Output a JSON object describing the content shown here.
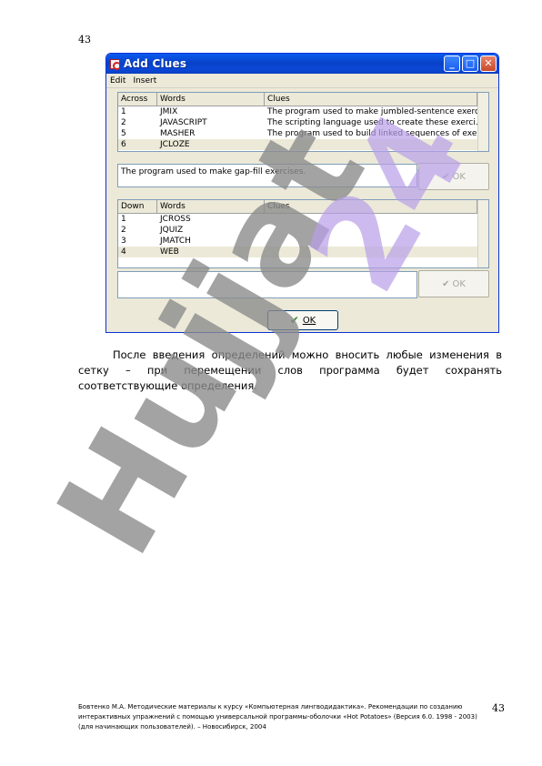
{
  "page": {
    "number_top": "43",
    "number_bottom": "43"
  },
  "dialog": {
    "title": "Add Clues",
    "menu": [
      "Edit",
      "Insert"
    ],
    "across": {
      "headers": [
        "Across",
        "Words",
        "Clues"
      ],
      "rows": [
        {
          "num": "1",
          "word": "JMIX",
          "clue": "The program used to make jumbled-sentence exerc..."
        },
        {
          "num": "2",
          "word": "JAVASCRIPT",
          "clue": "The scripting language used to create these exerci..."
        },
        {
          "num": "5",
          "word": "MASHER",
          "clue": "The program used to build linked sequences of exe..."
        },
        {
          "num": "6",
          "word": "JCLOZE",
          "clue": ""
        }
      ],
      "edit_value": "The program used to make gap-fill exercises.",
      "ok_label": "OK"
    },
    "down": {
      "headers": [
        "Down",
        "Words",
        "Clues"
      ],
      "rows": [
        {
          "num": "1",
          "word": "JCROSS",
          "clue": ""
        },
        {
          "num": "2",
          "word": "JQUIZ",
          "clue": ""
        },
        {
          "num": "3",
          "word": "JMATCH",
          "clue": ""
        },
        {
          "num": "4",
          "word": "WEB",
          "clue": ""
        }
      ],
      "edit_value": "",
      "ok_label": "OK"
    },
    "main_ok_label": "OK"
  },
  "paragraph": "После введения определений можно вносить любые изменения в сетку – при перемещении слов программа будет сохранять соответствующие определения.",
  "footer": "Бовтенко М.А. Методические материалы к курсу «Компьютерная лингводидактика». Рекомендации по созданию интерактивных упражнений с помощью универсальной программы-оболочки «Hot Potatoes» (Версия 6.0. 1998 - 2003) (для начинающих пользователей). – Новосибирск, 2004",
  "watermark": {
    "text": "Hujjat 24",
    "colors": {
      "left": "#8c8c8c",
      "right": "#b89ee8"
    }
  }
}
